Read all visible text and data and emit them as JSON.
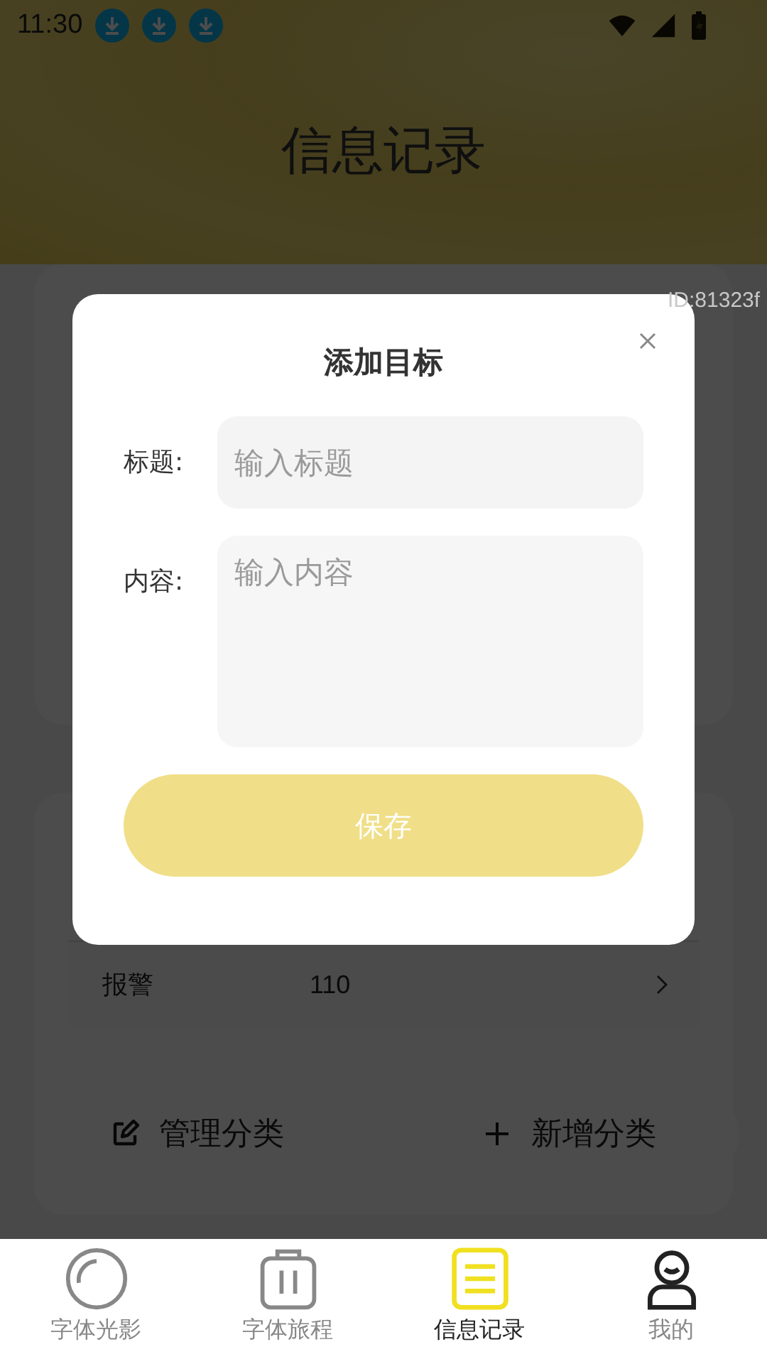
{
  "status_bar": {
    "time": "11:30",
    "notifications": [
      {
        "kind": "download"
      },
      {
        "kind": "download"
      },
      {
        "kind": "download"
      }
    ]
  },
  "header": {
    "title": "信息记录"
  },
  "id_label": "ID:81323f",
  "list": {
    "rows": [
      {
        "label": "报警",
        "value": "110"
      }
    ]
  },
  "actions": [
    {
      "kind": "edit",
      "label": "管理分类"
    },
    {
      "kind": "add",
      "label": "新增分类"
    }
  ],
  "dialog": {
    "title": "添加目标",
    "fields": [
      {
        "kind": "single",
        "label": "标题:",
        "placeholder": "输入标题"
      },
      {
        "kind": "multi",
        "label": "内容:",
        "placeholder": "输入内容"
      }
    ],
    "save_button": "保存"
  },
  "tabs": [
    {
      "kind": "lens",
      "label": "字体光影",
      "selected": false
    },
    {
      "kind": "suitcase",
      "label": "字体旅程",
      "selected": false
    },
    {
      "kind": "list",
      "label": "信息记录",
      "selected": true
    },
    {
      "kind": "person",
      "label": "我的",
      "selected": false
    }
  ]
}
